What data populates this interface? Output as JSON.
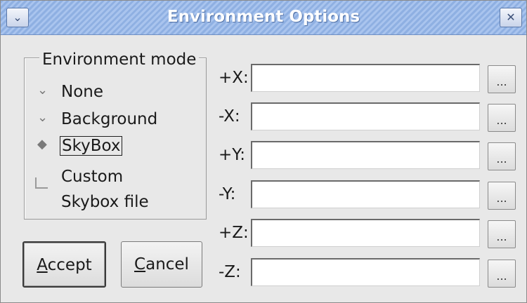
{
  "window": {
    "title": "Environment Options",
    "menu_icon": "chevron-down-icon",
    "close_icon": "close-icon"
  },
  "environment_mode": {
    "legend": "Environment mode",
    "options": [
      {
        "label": "None",
        "selected": false
      },
      {
        "label": "Background",
        "selected": false
      },
      {
        "label": "SkyBox",
        "selected": true
      }
    ],
    "custom_checkbox": {
      "label_line1": "Custom",
      "label_line2": "Skybox file",
      "checked": false
    }
  },
  "buttons": {
    "accept_mnemonic": "A",
    "accept_rest": "ccept",
    "cancel_mnemonic": "C",
    "cancel_rest": "ancel"
  },
  "faces": [
    {
      "label": "+X:",
      "value": "",
      "browse": "..."
    },
    {
      "label": "-X:",
      "value": "",
      "browse": "..."
    },
    {
      "label": "+Y:",
      "value": "",
      "browse": "..."
    },
    {
      "label": "-Y:",
      "value": "",
      "browse": "..."
    },
    {
      "label": "+Z:",
      "value": "",
      "browse": "..."
    },
    {
      "label": "-Z:",
      "value": "",
      "browse": "..."
    }
  ]
}
